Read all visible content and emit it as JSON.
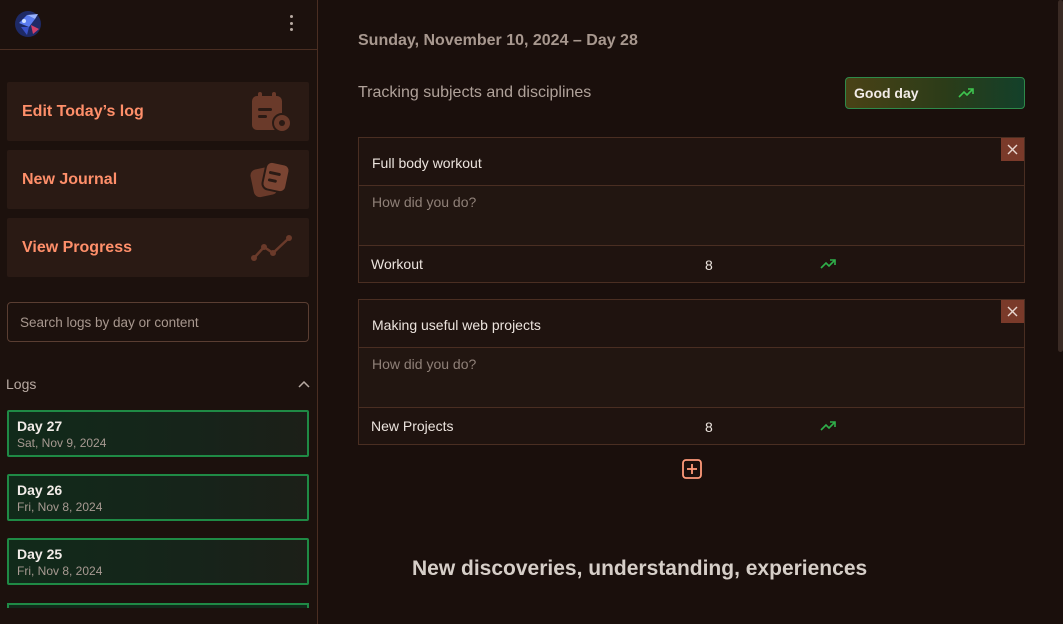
{
  "sidebar": {
    "logo": "app-logo-icon",
    "menu_icon": "kebab-menu-icon",
    "actions": [
      {
        "label": "Edit Today’s log",
        "icon": "calendar-edit-icon"
      },
      {
        "label": "New Journal",
        "icon": "journal-notes-icon"
      },
      {
        "label": "View Progress",
        "icon": "progress-chart-icon"
      }
    ],
    "search": {
      "placeholder": "Search logs by day or content"
    },
    "logs_title": "Logs",
    "logs": [
      {
        "day": "Day 27",
        "date": "Sat, Nov 9, 2024"
      },
      {
        "day": "Day 26",
        "date": "Fri, Nov 8, 2024"
      },
      {
        "day": "Day 25",
        "date": "Fri, Nov 8, 2024"
      }
    ]
  },
  "main": {
    "date_line": "Sunday, November 10, 2024 – Day 28",
    "subtitle": "Tracking subjects and disciplines",
    "day_badge": "Good day",
    "cards": [
      {
        "title": "Full body workout",
        "placeholder": "How did you do?",
        "metric": "Workout",
        "value": "8"
      },
      {
        "title": "Making useful web projects",
        "placeholder": "How did you do?",
        "metric": "New Projects",
        "value": "8"
      }
    ],
    "section_heading": "New discoveries, understanding, experiences"
  },
  "colors": {
    "accent": "#ff8f6a",
    "success": "#1f8a45",
    "trend_green": "#2fb04a",
    "background": "#1a0f0c"
  }
}
